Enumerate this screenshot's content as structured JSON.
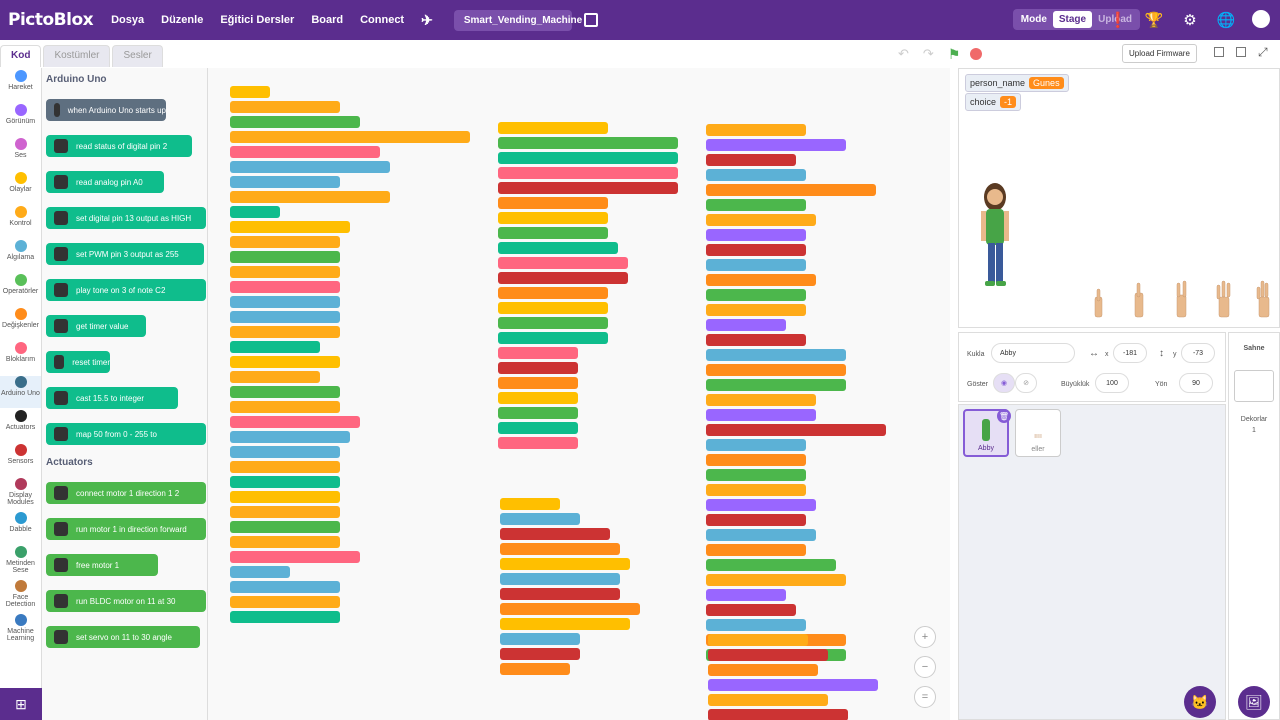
{
  "app": {
    "logo": "PictoBlox",
    "menu": [
      "Dosya",
      "Düzenle",
      "Eğitici Dersler",
      "Board",
      "Connect"
    ],
    "project": "Smart_Vending_Machine",
    "mode_label": "Mode",
    "mode_stage": "Stage",
    "mode_upload": "Upload"
  },
  "tabs": [
    "Kod",
    "Kostümler",
    "Sesler"
  ],
  "categories": [
    {
      "label": "Hareket",
      "color": "#4c97ff"
    },
    {
      "label": "Görünüm",
      "color": "#9966ff"
    },
    {
      "label": "Ses",
      "color": "#cf63cf"
    },
    {
      "label": "Olaylar",
      "color": "#ffbf00"
    },
    {
      "label": "Kontrol",
      "color": "#ffab19"
    },
    {
      "label": "Algılama",
      "color": "#5cb1d6"
    },
    {
      "label": "Operatörler",
      "color": "#59c059"
    },
    {
      "label": "Değişkenler",
      "color": "#ff8c1a"
    },
    {
      "label": "Bloklarım",
      "color": "#ff6680"
    },
    {
      "label": "Arduino Uno",
      "color": "#3a6e8a"
    },
    {
      "label": "Actuators",
      "color": "#222222"
    },
    {
      "label": "Sensors",
      "color": "#cc3333"
    },
    {
      "label": "Display Modules",
      "color": "#b03a5b"
    },
    {
      "label": "Dabble",
      "color": "#2c9ad1"
    },
    {
      "label": "Metinden Sese",
      "color": "#3aa06a"
    },
    {
      "label": "Face Detection",
      "color": "#c07a3a"
    },
    {
      "label": "Machine Learning",
      "color": "#3a7ac0"
    }
  ],
  "palette": {
    "section1": "Arduino Uno",
    "blocks1": [
      {
        "text": "when Arduino Uno starts up",
        "color": "#5e6f80"
      },
      {
        "text": "read status of digital pin  2",
        "color": "#0fbd8c"
      },
      {
        "text": "read analog pin  A0",
        "color": "#0fbd8c"
      },
      {
        "text": "set digital pin  13  output as  HIGH",
        "color": "#0fbd8c"
      },
      {
        "text": "set PWM pin  3  output as  255",
        "color": "#0fbd8c"
      },
      {
        "text": "play tone on  3  of note  C2",
        "color": "#0fbd8c"
      },
      {
        "text": "get timer value",
        "color": "#0fbd8c"
      },
      {
        "text": "reset timer",
        "color": "#0fbd8c"
      },
      {
        "text": "cast  15.5  to  integer",
        "color": "#0fbd8c"
      },
      {
        "text": "map  50  from  0  -  255  to",
        "color": "#0fbd8c"
      }
    ],
    "section2": "Actuators",
    "blocks2": [
      {
        "text": "connect motor  1  direction 1  2",
        "color": "#4cb74c"
      },
      {
        "text": "run motor  1  in direction  forward",
        "color": "#4cb74c"
      },
      {
        "text": "free  motor  1",
        "color": "#4cb74c"
      },
      {
        "text": "run BLDC motor on  11  at  30",
        "color": "#4cb74c"
      },
      {
        "text": "set servo on  11  to  30  angle",
        "color": "#4cb74c"
      }
    ]
  },
  "stage": {
    "monitors": [
      {
        "label": "person_name",
        "value": "Gunes"
      },
      {
        "label": "choice",
        "value": "-1"
      }
    ],
    "upload_firmware": "Upload Firmware"
  },
  "sprite": {
    "label_sprite": "Kukla",
    "name": "Abby",
    "x_label": "x",
    "x": "-181",
    "y_label": "y",
    "y": "-73",
    "show_label": "Göster",
    "size_label": "Büyüklük",
    "size": "100",
    "dir_label": "Yön",
    "direction": "90"
  },
  "sprites": [
    {
      "name": "Abby"
    },
    {
      "name": "eller"
    }
  ],
  "stage_panel": {
    "title": "Sahne",
    "backdrops_label": "Dekorlar",
    "backdrops_count": "1"
  }
}
